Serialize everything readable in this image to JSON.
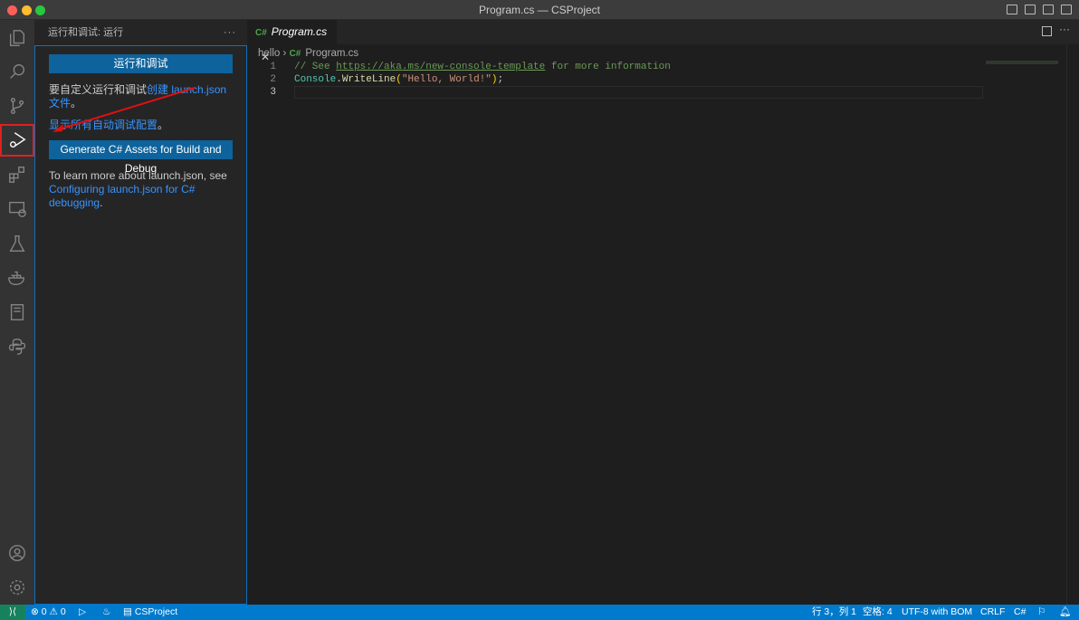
{
  "window": {
    "title": "Program.cs — CSProject"
  },
  "sidebar": {
    "title": "运行和调试: 运行",
    "more": "···",
    "run_button": "运行和调试",
    "custom_text": "要自定义运行和调试",
    "create_link": "创建 launch.json 文件",
    "period": "。",
    "show_all_link": "显示所有自动调试配置",
    "period2": "。",
    "generate_button": "Generate C# Assets for Build and Debug",
    "learn_text": "To learn more about launch.json, see",
    "learn_link": "Configuring launch.json for C# debugging",
    "period3": "."
  },
  "editor": {
    "tab": {
      "icon": "C#",
      "label": "Program.cs",
      "close": "✕"
    },
    "breadcrumb": {
      "folder": "hello",
      "sep": "›",
      "icon": "C#",
      "file": "Program.cs"
    },
    "lines": [
      {
        "n": "1",
        "comment": "// See ",
        "url": "https://aka.ms/new-console-template",
        "rest": " for more information"
      },
      {
        "n": "2",
        "cls": "Console",
        "dot": ".",
        "method": "WriteLine",
        "open": "(",
        "str": "\"Hello, World!\"",
        "close": ")",
        "semi": ";"
      },
      {
        "n": "3"
      }
    ]
  },
  "statusbar": {
    "remote": "⟩⟨",
    "errors": "0",
    "warnings": "0",
    "project": "CSProject",
    "position": "行 3，列 1",
    "spaces": "空格: 4",
    "encoding": "UTF-8 with BOM",
    "eol": "CRLF",
    "language": "C#"
  }
}
